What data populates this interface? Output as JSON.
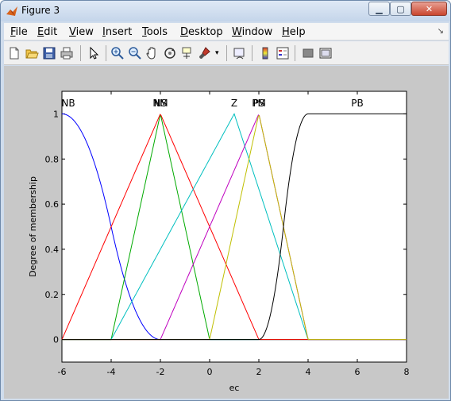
{
  "window": {
    "title": "Figure 3",
    "minimize_glyph": "▁",
    "maximize_glyph": "▢",
    "close_glyph": "✕"
  },
  "menu": {
    "items": [
      {
        "label_u": "F",
        "label_rest": "ile"
      },
      {
        "label_u": "E",
        "label_rest": "dit"
      },
      {
        "label_u": "V",
        "label_rest": "iew"
      },
      {
        "label_u": "I",
        "label_rest": "nsert"
      },
      {
        "label_u": "T",
        "label_rest": "ools"
      },
      {
        "label_u": "D",
        "label_rest": "esktop"
      },
      {
        "label_u": "W",
        "label_rest": "indow"
      },
      {
        "label_u": "H",
        "label_rest": "elp"
      }
    ],
    "overflow_glyph": "↘"
  },
  "toolbar": {
    "icons": [
      "new-figure-icon",
      "open-file-icon",
      "save-icon",
      "print-icon",
      "select-arrow-icon",
      "zoom-in-icon",
      "zoom-out-icon",
      "pan-hand-icon",
      "rotate-3d-icon",
      "data-cursor-icon",
      "brush-icon",
      "brush-dropdown-icon",
      "link-plot-icon",
      "insert-colorbar-icon",
      "insert-legend-icon",
      "hide-plot-tools-icon",
      "show-plot-tools-icon"
    ]
  },
  "colors": {
    "NB": "#0000ff",
    "NM": "#00aa00",
    "NS": "#ff0000",
    "Z": "#00bfbf",
    "PS": "#bf00bf",
    "PM": "#bfbf00",
    "PB": "#000000",
    "axes_bg": "#ffffff",
    "figure_bg": "#c8c8c8"
  },
  "chart_data": {
    "type": "line",
    "title": "",
    "xlabel": "ec",
    "ylabel": "Degree of membership",
    "xlim": [
      -6,
      8
    ],
    "ylim": [
      -0.1,
      1.1
    ],
    "xticks": [
      -6,
      -4,
      -2,
      0,
      2,
      4,
      6,
      8
    ],
    "yticks": [
      0,
      0.2,
      0.4,
      0.6,
      0.8,
      1
    ],
    "ytick_labels": [
      "0",
      "0.2",
      "0.4",
      "0.6",
      "0.8",
      "1"
    ],
    "grid": false,
    "legend": "none",
    "series": [
      {
        "name": "NB",
        "shape": "zmf",
        "params": [
          -6,
          -2
        ],
        "color_key": "NB"
      },
      {
        "name": "NM",
        "shape": "trimf",
        "params": [
          -4,
          -2,
          0
        ],
        "color_key": "NM"
      },
      {
        "name": "NS",
        "shape": "trimf",
        "params": [
          -6,
          -2,
          2
        ],
        "color_key": "NS"
      },
      {
        "name": "Z",
        "shape": "trimf",
        "params": [
          -4,
          1,
          4
        ],
        "color_key": "Z"
      },
      {
        "name": "PS",
        "shape": "trimf",
        "params": [
          -2,
          2,
          4
        ],
        "color_key": "PS"
      },
      {
        "name": "PM",
        "shape": "trimf",
        "params": [
          0,
          2,
          4
        ],
        "color_key": "PM"
      },
      {
        "name": "PB",
        "shape": "smf",
        "params": [
          2,
          4
        ],
        "color_key": "PB"
      }
    ],
    "set_labels": [
      {
        "text": "NB",
        "x": -6
      },
      {
        "text": "NM",
        "x": -2
      },
      {
        "text": "NS",
        "x": -2
      },
      {
        "text": "Z",
        "x": 1
      },
      {
        "text": "PS",
        "x": 2
      },
      {
        "text": "PM",
        "x": 2
      },
      {
        "text": "PB",
        "x": 6
      }
    ]
  }
}
